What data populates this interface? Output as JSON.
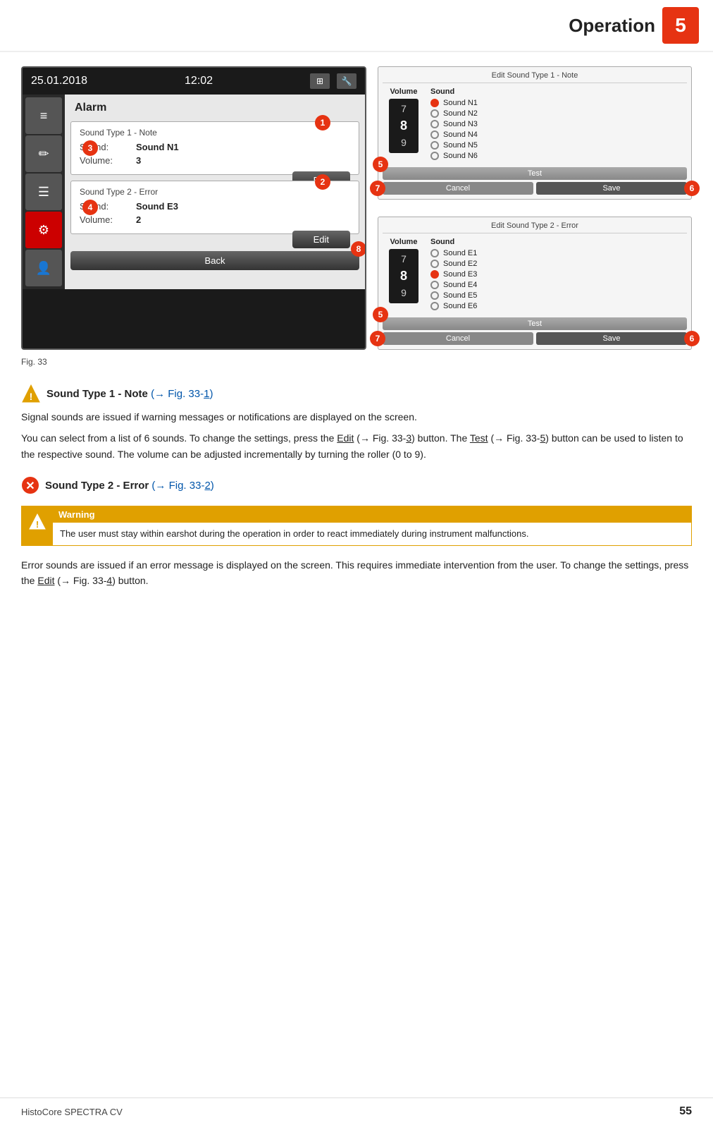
{
  "page": {
    "chapter_number": "5",
    "chapter_title": "Operation",
    "figure_number": "Fig.  33"
  },
  "device_screen": {
    "date": "25.01.2018",
    "time": "12:02",
    "alarm_title": "Alarm",
    "sound_type_1": {
      "label": "Sound Type 1 - Note",
      "sound_label": "Sound:",
      "sound_value": "Sound N1",
      "volume_label": "Volume:",
      "volume_value": "3",
      "edit_btn": "Edit"
    },
    "sound_type_2": {
      "label": "Sound Type 2 - Error",
      "sound_label": "Sound:",
      "sound_value": "Sound E3",
      "volume_label": "Volume:",
      "volume_value": "2",
      "edit_btn": "Edit"
    },
    "back_btn": "Back"
  },
  "edit_panel_1": {
    "title": "Edit Sound Type 1 - Note",
    "volume_header": "Volume",
    "sound_header": "Sound",
    "volume_numbers": [
      "7",
      "8",
      "9"
    ],
    "sounds": [
      {
        "label": "Sound N1",
        "selected": true
      },
      {
        "label": "Sound N2",
        "selected": false
      },
      {
        "label": "Sound N3",
        "selected": false
      },
      {
        "label": "Sound N4",
        "selected": false
      },
      {
        "label": "Sound N5",
        "selected": false
      },
      {
        "label": "Sound N6",
        "selected": false
      }
    ],
    "test_btn": "Test",
    "cancel_btn": "Cancel",
    "save_btn": "Save"
  },
  "edit_panel_2": {
    "title": "Edit Sound Type 2 - Error",
    "volume_header": "Volume",
    "sound_header": "Sound",
    "volume_numbers": [
      "7",
      "8",
      "9"
    ],
    "sounds": [
      {
        "label": "Sound E1",
        "selected": false
      },
      {
        "label": "Sound E2",
        "selected": false
      },
      {
        "label": "Sound E3",
        "selected": true
      },
      {
        "label": "Sound E4",
        "selected": false
      },
      {
        "label": "Sound E5",
        "selected": false
      },
      {
        "label": "Sound E6",
        "selected": false
      }
    ],
    "test_btn": "Test",
    "cancel_btn": "Cancel",
    "save_btn": "Save"
  },
  "badges": {
    "b1": "1",
    "b2": "2",
    "b3": "3",
    "b4": "4",
    "b5": "5",
    "b6": "6",
    "b7": "7",
    "b8": "8"
  },
  "section1": {
    "title": "Sound Type 1 - Note",
    "ref": "(→ Fig.  33-1)",
    "para1": "Signal sounds are issued if warning messages or notifications are displayed on the screen.",
    "para2_start": "You can select from a list of 6 sounds. To change the settings, press the ",
    "edit_link": "Edit",
    "para2_mid": " (→ Fig.  33-",
    "para2_num": "3",
    "para2_end": ") button.",
    "para3_start": "The ",
    "test_link": "Test",
    "para3_mid": " (→ Fig.  33-",
    "para3_num": "5",
    "para3_end": ") button can be used to listen to the respective sound. The volume can be adjusted incrementally by turning the roller (0 to 9)."
  },
  "section2": {
    "title": "Sound Type 2 - Error",
    "ref": "(→ Fig.  33-2)"
  },
  "warning": {
    "title": "Warning",
    "text": "The user must stay within earshot during the operation in order to react immediately during instrument malfunctions."
  },
  "section2_body": {
    "para1_start": "Error sounds are issued if an error message is displayed on the screen. This requires immediate intervention from the user. To change the settings, press the ",
    "edit_link": "Edit",
    "para1_mid": " (→ Fig.  33-",
    "para1_num": "4",
    "para1_end": ") button."
  },
  "footer": {
    "product": "HistoCore SPECTRA CV",
    "page_number": "55"
  }
}
